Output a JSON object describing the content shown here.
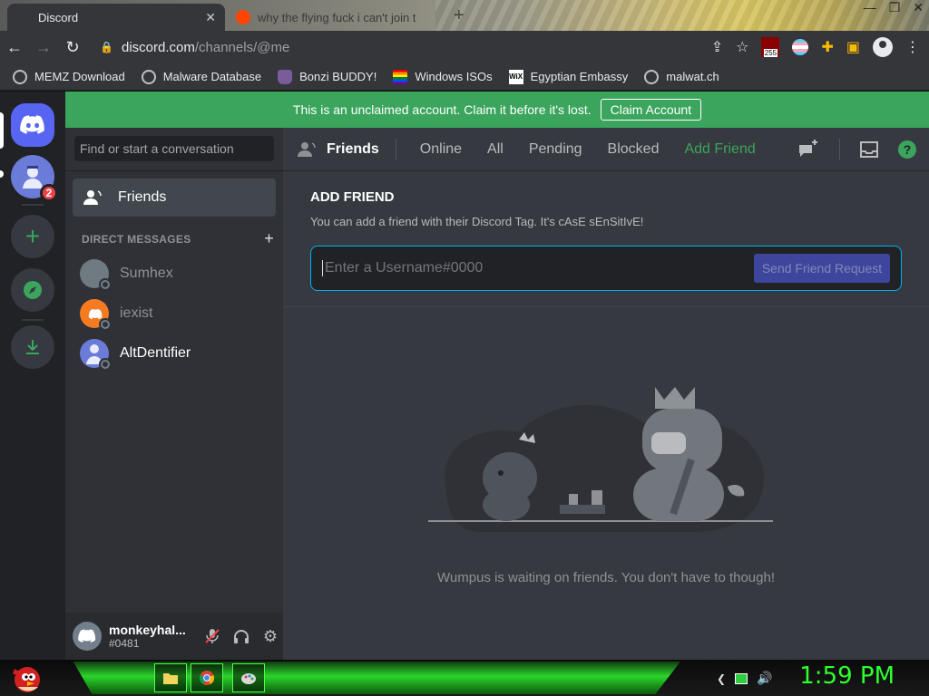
{
  "browser": {
    "tabs": [
      {
        "title": "Discord",
        "active": true
      },
      {
        "title": "why the flying fuck i can't join t",
        "active": false
      }
    ],
    "new_tab_symbol": "+",
    "address": {
      "host": "discord.com",
      "path": "/channels/@me"
    },
    "ext_badge": "255",
    "bookmarks": [
      {
        "label": "MEMZ Download",
        "icon": "globe-icon"
      },
      {
        "label": "Malware Database",
        "icon": "globe-icon"
      },
      {
        "label": "Bonzi BUDDY!",
        "icon": "bonzi-icon"
      },
      {
        "label": "Windows ISOs",
        "icon": "rainbow-flag-icon"
      },
      {
        "label": "Egyptian Embassy",
        "icon": "wix-icon"
      },
      {
        "label": "malwat.ch",
        "icon": "globe-icon"
      }
    ]
  },
  "discord": {
    "banner": {
      "text": "This is an unclaimed account. Claim it before it's lost.",
      "button": "Claim Account"
    },
    "rail": {
      "mention_count": "2"
    },
    "sidebar": {
      "search_placeholder": "Find or start a conversation",
      "friends_label": "Friends",
      "dm_header": "DIRECT MESSAGES",
      "dms": [
        {
          "name": "Sumhex",
          "color": "#6f7a82"
        },
        {
          "name": "iexist",
          "color": "#f47b20"
        },
        {
          "name": "AltDentifier",
          "color": "#6b7bd8"
        }
      ]
    },
    "user": {
      "name": "monkeyhal...",
      "tag": "#0481"
    },
    "header": {
      "title": "Friends",
      "tabs": [
        "Online",
        "All",
        "Pending",
        "Blocked"
      ],
      "add_friend": "Add Friend",
      "help": "?"
    },
    "add_friend": {
      "title": "ADD FRIEND",
      "description": "You can add a friend with their Discord Tag. It's cAsE sEnSitIvE!",
      "placeholder": "Enter a Username#0000",
      "button": "Send Friend Request"
    },
    "empty_state": "Wumpus is waiting on friends. You don't have to though!"
  },
  "taskbar": {
    "clock": "1:59 PM"
  },
  "colors": {
    "blurple": "#5865f2",
    "green": "#3ba55d",
    "bg": "#36393f"
  }
}
